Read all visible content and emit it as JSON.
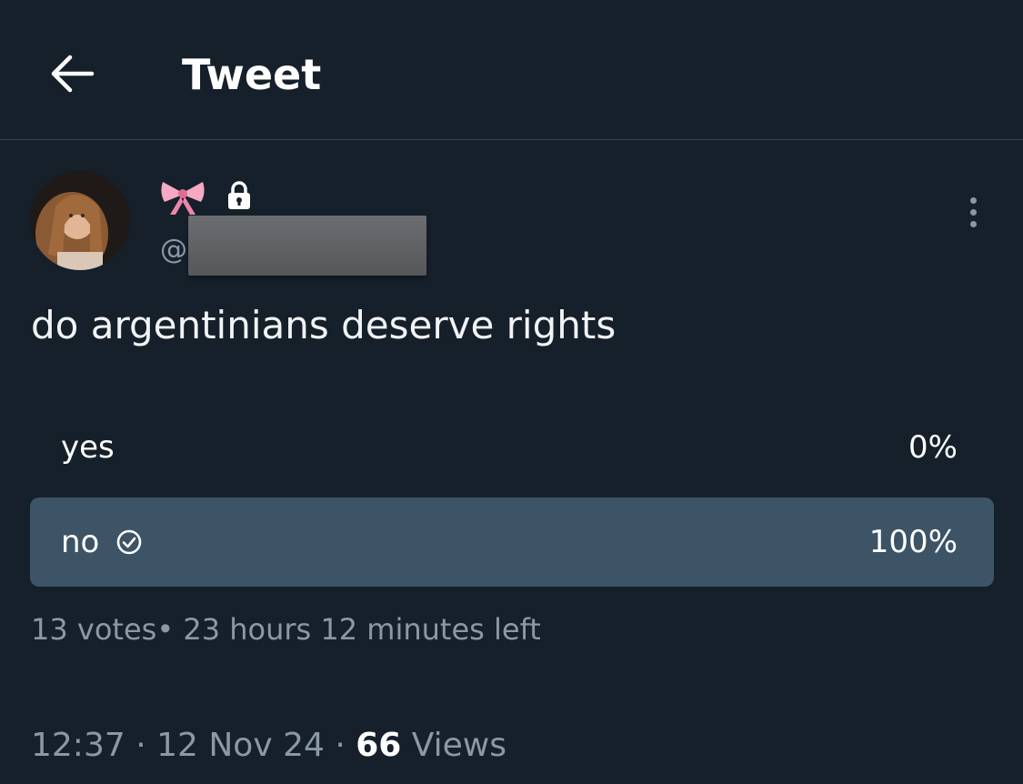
{
  "header": {
    "back_icon": "arrow-left-icon",
    "title": "Tweet"
  },
  "author": {
    "display_name_icons": [
      "pink-bow-emoji",
      "lock-icon"
    ],
    "handle_prefix": "@",
    "handle_redacted": true
  },
  "tweet": {
    "text": "do argentinians deserve rights"
  },
  "poll": {
    "options": [
      {
        "label": "yes",
        "percent_text": "0%",
        "fraction": 0.0,
        "selected": false
      },
      {
        "label": "no",
        "percent_text": "100%",
        "fraction": 1.0,
        "selected": true
      }
    ],
    "votes_text": "13 votes",
    "separator": "•",
    "time_left": "23 hours 12 minutes left"
  },
  "meta": {
    "time": "12:37",
    "date": "12 Nov 24",
    "views_count": "66",
    "views_label": "Views",
    "separator": "·"
  },
  "colors": {
    "background": "#15202b",
    "poll_fill": "#3d5466",
    "secondary_text": "#8b98a5",
    "divider": "#38444d"
  }
}
